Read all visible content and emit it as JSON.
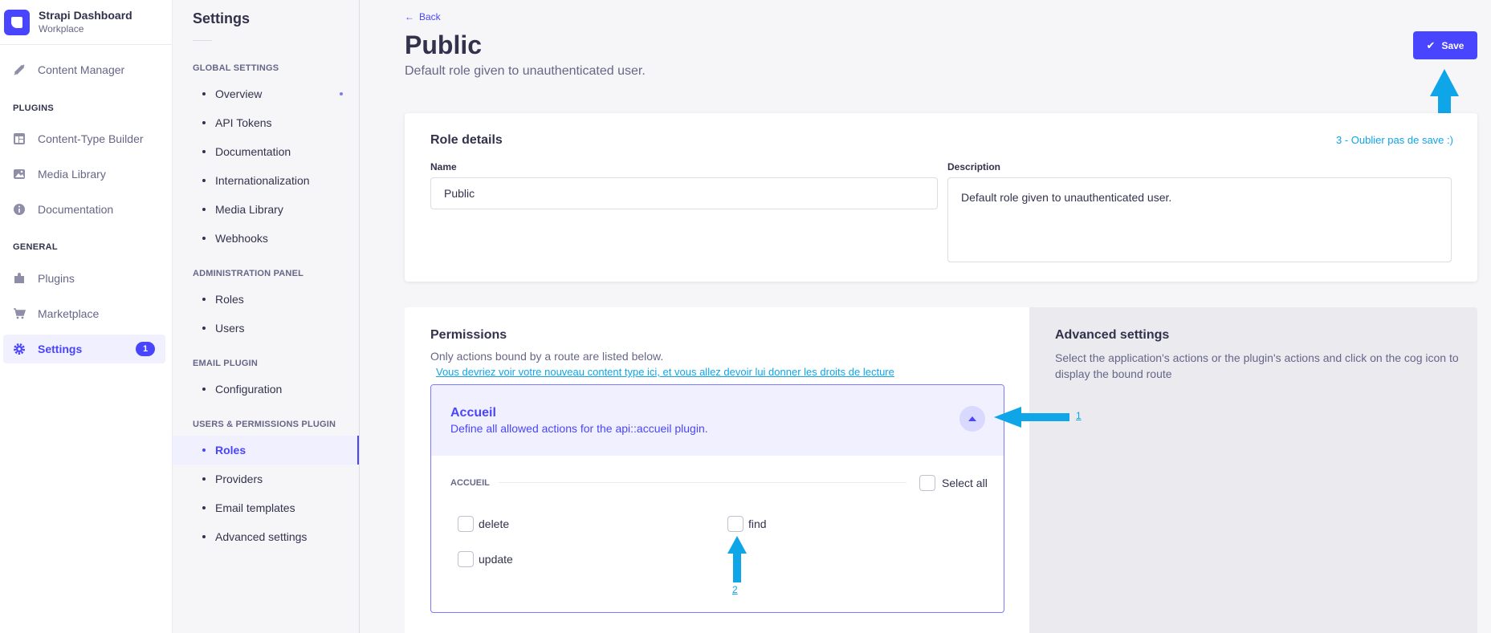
{
  "brand": {
    "title": "Strapi Dashboard",
    "subtitle": "Workplace"
  },
  "mainnav": {
    "content_manager": "Content Manager",
    "plugins_section": "PLUGINS",
    "plugins": [
      "Content-Type Builder",
      "Media Library",
      "Documentation"
    ],
    "general_section": "GENERAL",
    "general": [
      "Plugins",
      "Marketplace",
      "Settings"
    ],
    "settings_badge": "1"
  },
  "subnav": {
    "title": "Settings",
    "global_section": "GLOBAL SETTINGS",
    "global": [
      "Overview",
      "API Tokens",
      "Documentation",
      "Internationalization",
      "Media Library",
      "Webhooks"
    ],
    "admin_section": "ADMINISTRATION PANEL",
    "admin": [
      "Roles",
      "Users"
    ],
    "email_section": "EMAIL PLUGIN",
    "email": [
      "Configuration"
    ],
    "up_section": "USERS & PERMISSIONS PLUGIN",
    "up": [
      "Roles",
      "Providers",
      "Email templates",
      "Advanced settings"
    ]
  },
  "header": {
    "back": "Back",
    "title": "Public",
    "subtitle": "Default role given to unauthenticated user.",
    "save": "Save"
  },
  "role_details": {
    "title": "Role details",
    "name_label": "Name",
    "name_value": "Public",
    "description_label": "Description",
    "description_value": "Default role given to unauthenticated user."
  },
  "annotations": {
    "save_note": "3 - Oublier pas de save :)",
    "content_type_note": "Vous devriez voir votre nouveau content type ici, et vous allez devoir lui donner les droits de lecture",
    "marker_1": "1",
    "marker_2": "2"
  },
  "permissions": {
    "title": "Permissions",
    "subtitle": "Only actions bound by a route are listed below.",
    "accordion": {
      "title": "Accueil",
      "description": "Define all allowed actions for the api::accueil plugin.",
      "section": "ACCUEIL",
      "select_all": "Select all",
      "actions": [
        "delete",
        "find",
        "update"
      ]
    }
  },
  "advanced": {
    "title": "Advanced settings",
    "text": "Select the application's actions or the plugin's actions and click on the cog icon to display the bound route"
  },
  "colors": {
    "accent": "#4945ff",
    "annotation": "#0ea5e9"
  }
}
